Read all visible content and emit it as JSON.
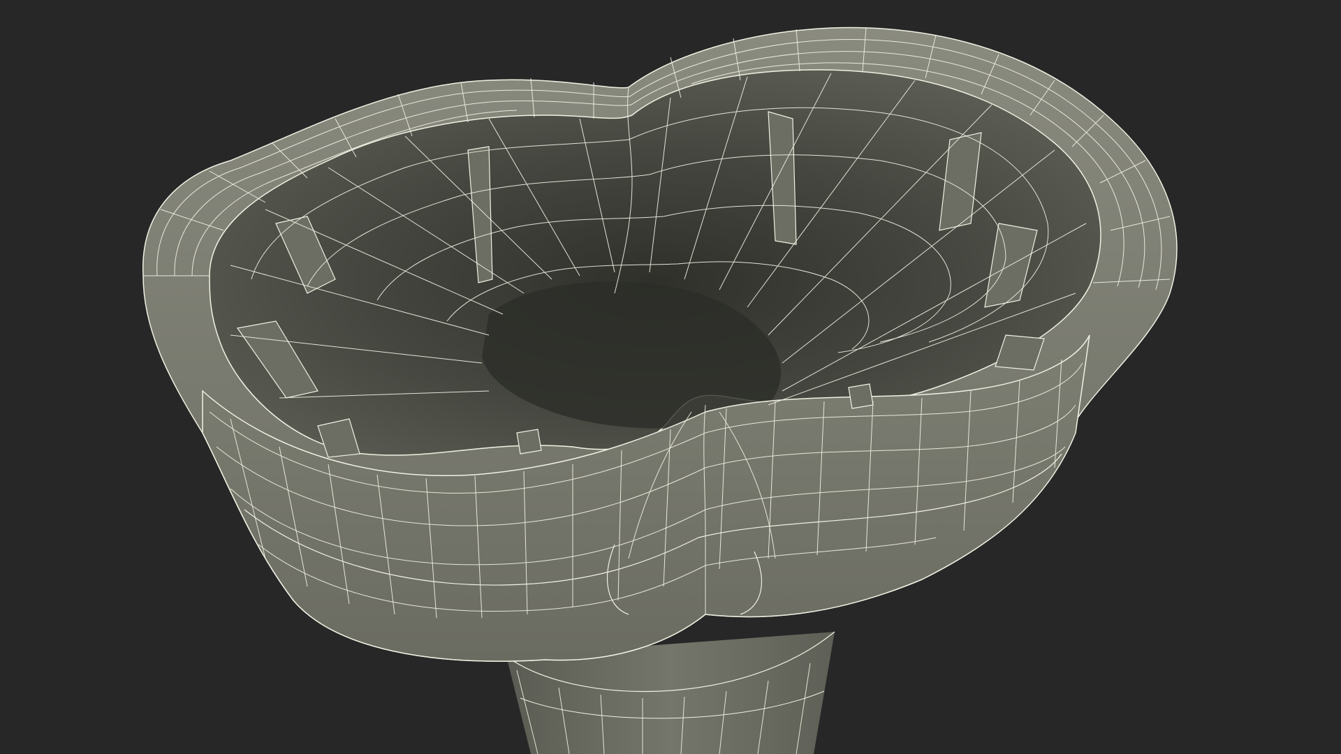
{
  "scene": {
    "subject": "wireframe-cup-holder-model",
    "colors": {
      "background": "#272727",
      "surface_light": "#7b7c70",
      "surface_mid": "#6a6b61",
      "surface_dark": "#4a4b43",
      "interior_deep": "#3b3c35",
      "wire": "#f1f1e4"
    }
  }
}
